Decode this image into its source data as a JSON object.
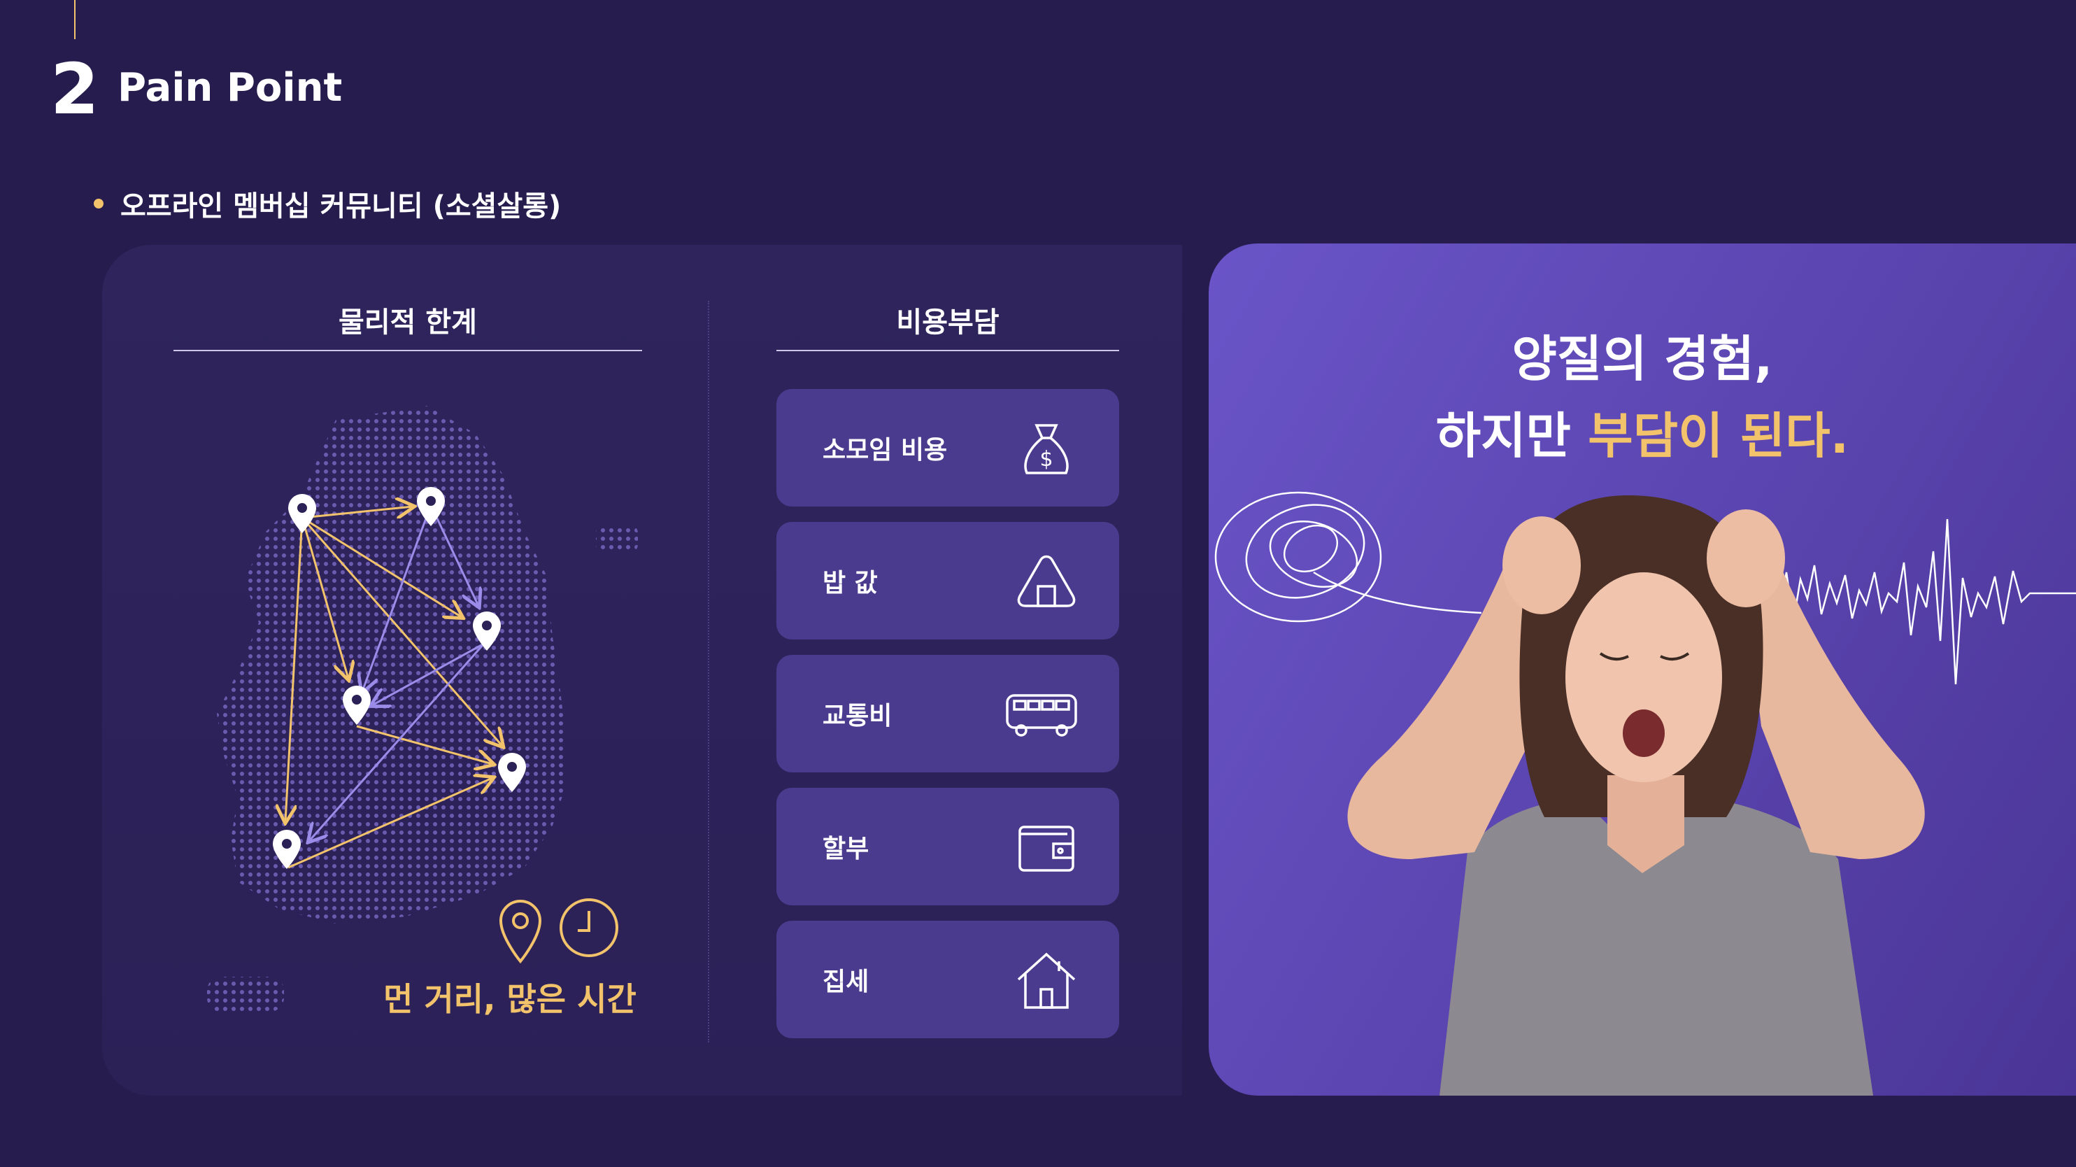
{
  "section": {
    "number": "2",
    "title": "Pain Point"
  },
  "bullet": "오프라인 멤버십 커뮤니티 (소셜살롱)",
  "left": {
    "heading": "물리적 한계",
    "tagline": "먼 거리, 많은 시간",
    "icons": [
      "location-pin-icon",
      "clock-icon"
    ]
  },
  "middle": {
    "heading": "비용부담",
    "items": [
      {
        "label": "소모임 비용",
        "icon": "money-bag-icon"
      },
      {
        "label": "밥 값",
        "icon": "rice-ball-icon"
      },
      {
        "label": "교통비",
        "icon": "bus-icon"
      },
      {
        "label": "할부",
        "icon": "wallet-icon"
      },
      {
        "label": "집세",
        "icon": "house-icon"
      }
    ]
  },
  "right": {
    "line1": "양질의 경험,",
    "line2_plain": "하지만 ",
    "line2_highlight": "부담이 된다."
  },
  "colors": {
    "background": "#261d4e",
    "accent": "#f2c36b",
    "card": "#4a3b8e",
    "purple_arrow": "#9a8ce8"
  }
}
